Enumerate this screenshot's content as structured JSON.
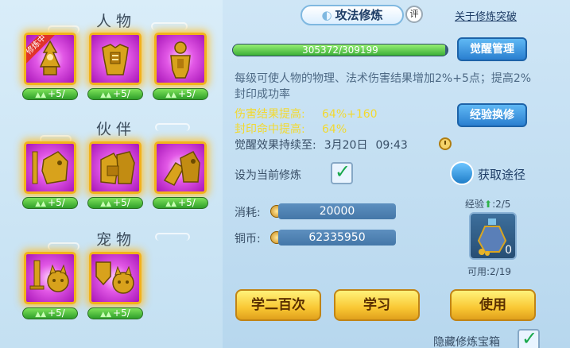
{
  "left": {
    "sections": {
      "character": "人物",
      "partner": "伙伴",
      "pet": "宠物"
    },
    "character_cards": [
      {
        "icon": "amulet-icon",
        "tag": "修炼中",
        "level": "+5/"
      },
      {
        "icon": "armor-icon",
        "tag": "",
        "level": "+5/"
      },
      {
        "icon": "warrior-icon",
        "tag": "",
        "level": "+5/"
      }
    ],
    "partner_cards": [
      {
        "icon": "beast-sword-icon",
        "level": "+5/"
      },
      {
        "icon": "beast-armor-icon",
        "level": "+5/"
      },
      {
        "icon": "beast-claw-icon",
        "level": "+5/"
      }
    ],
    "pet_cards": [
      {
        "icon": "pet-sword-icon",
        "level": "+5/"
      },
      {
        "icon": "pet-shield-icon",
        "level": "+5/"
      }
    ]
  },
  "header": {
    "title": "攻法修炼",
    "rate_label": "评",
    "about_link": "关于修炼突破"
  },
  "progress": {
    "text": "305372/309199",
    "value": 305372,
    "max": 309199
  },
  "buttons": {
    "awaken_manage": "觉醒管理",
    "exp_exchange": "经验换修",
    "learn_200": "学二百次",
    "learn": "学习",
    "use": "使用"
  },
  "description": "每级可使人物的物理、法术伤害结果增加2%+5点；提高2%封印成功率",
  "effects": [
    {
      "label": "伤害结果提高:",
      "value": "64%+160"
    },
    {
      "label": "封印命中提高:",
      "value": "64%"
    }
  ],
  "duration": {
    "label": "觉醒效果持续至:",
    "date": "3月20日",
    "time": "09:43"
  },
  "set_current": {
    "label": "设为当前修炼",
    "checked": true
  },
  "obtain_label": "获取途径",
  "costs": {
    "consume_label": "消耗:",
    "consume_value": "20000",
    "coins_label": "铜币:",
    "coins_value": "62335950"
  },
  "exp_item": {
    "label": "经验",
    "ratio": ":2/5",
    "count": "0",
    "available": "可用:2/19",
    "icon": "vase-icon"
  },
  "hide_box": {
    "label": "隐藏修炼宝箱",
    "checked": true
  },
  "colors": {
    "card_frame": "#f2b21c",
    "card_bg": "#a815b8",
    "effect_text": "#f2d930",
    "level_bar": "#3bae38"
  }
}
